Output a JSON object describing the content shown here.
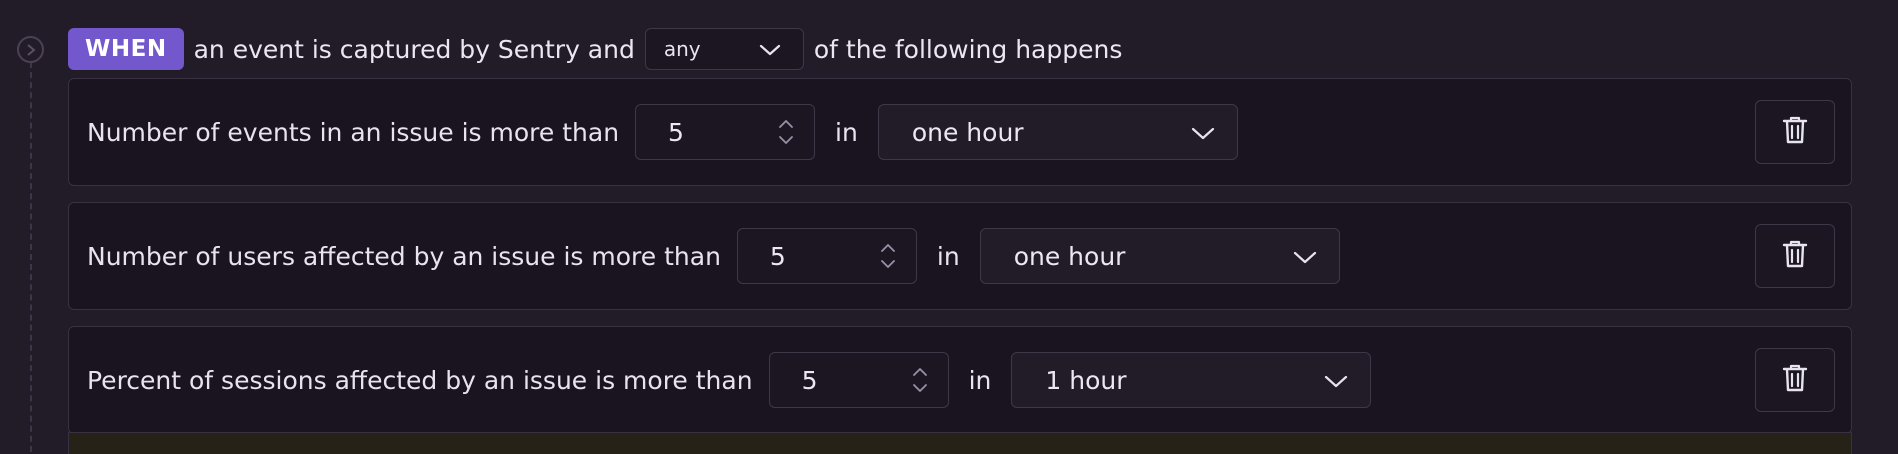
{
  "header": {
    "when_badge": "WHEN",
    "prefix_text": "an event is captured by Sentry and",
    "match_select_value": "any",
    "suffix_text": "of the following happens"
  },
  "conditions": [
    {
      "label": "Number of events in an issue is more than",
      "value": "5",
      "in_label": "in",
      "interval": "one hour"
    },
    {
      "label": "Number of users affected by an issue is more than",
      "value": "5",
      "in_label": "in",
      "interval": "one hour"
    },
    {
      "label": "Percent of sessions affected by an issue is more than",
      "value": "5",
      "in_label": "in",
      "interval": "1 hour"
    }
  ],
  "icons": {
    "timeline": "chevron-right-circle-icon",
    "select_arrow": "chevron-down-icon",
    "stepper": "stepper-icon",
    "delete": "trash-icon"
  },
  "colors": {
    "background": "#221c29",
    "row_background": "#1a1420",
    "accent": "#7357cc",
    "border": "#3f3748"
  }
}
